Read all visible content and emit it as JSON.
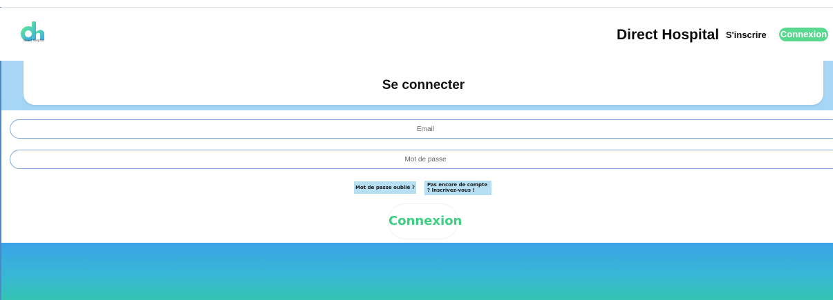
{
  "header": {
    "logo_caption": "Direct Hospital",
    "brand": "Direct Hospital",
    "nav": {
      "signup_label": "S'inscrire",
      "login_label": "Connexion"
    }
  },
  "login": {
    "title": "Se connecter",
    "email_placeholder": "Email",
    "password_placeholder": "Mot de passe",
    "forgot_password": "Mot de passe oublié ?",
    "register_prompt": "Pas encore de compte ? Inscrivez-vous !",
    "submit_label": "Connexion"
  },
  "colors": {
    "accent_green": "#58d98f",
    "chip_blue": "#b6dff4",
    "band_blue": "#a9d6f6"
  },
  "icons": {
    "logo": "dh-logo-icon"
  }
}
